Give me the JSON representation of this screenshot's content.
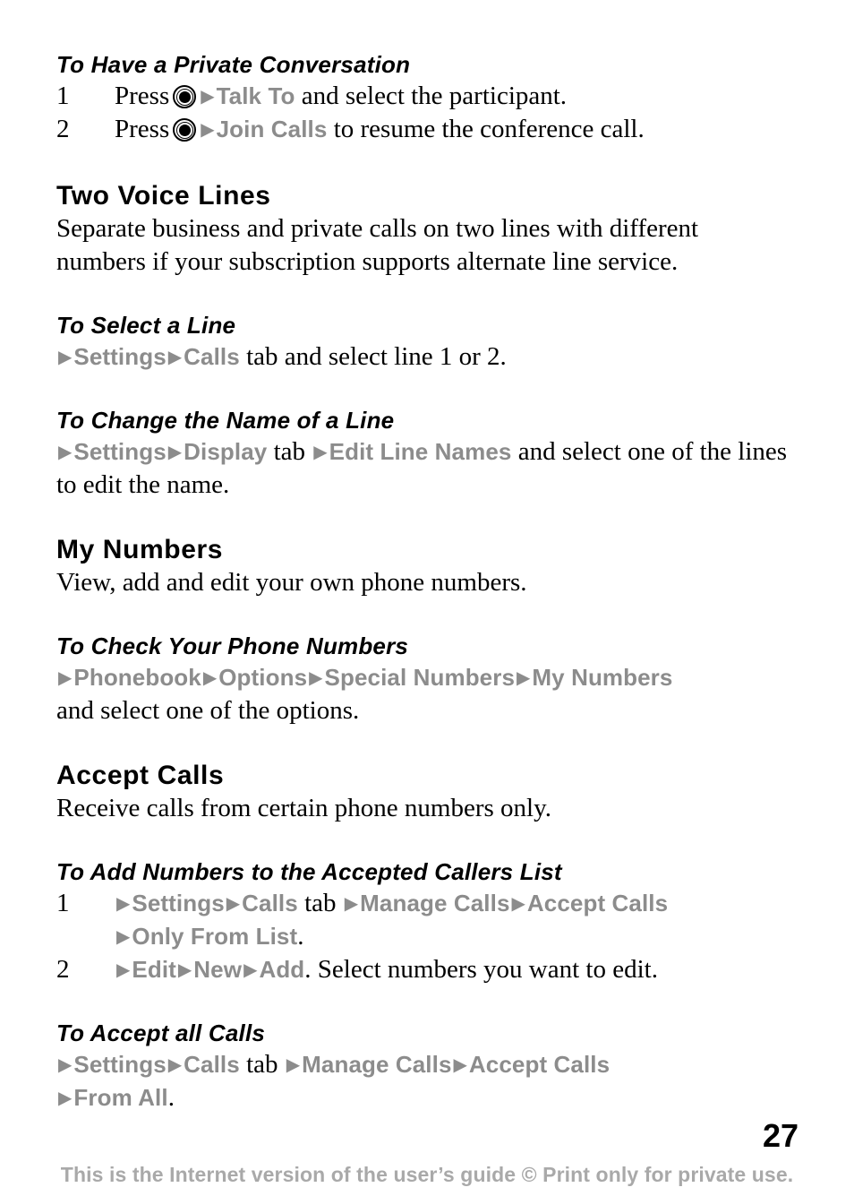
{
  "document": {
    "page_number": "27",
    "footer_note": "This is the Internet version of the user’s guide © Print only for private use.",
    "colors": {
      "menu_term": "#8c8c8c",
      "footer": "#a9a9a9",
      "body_text": "#000000"
    },
    "icons": {
      "joystick": "joystick-icon",
      "arrow": "▶"
    }
  },
  "sections": {
    "private_conversation": {
      "heading": "To Have a Private Conversation",
      "steps": [
        {
          "number": "1",
          "press_label": "Press",
          "menu": "Talk To",
          "tail": " and select the participant."
        },
        {
          "number": "2",
          "press_label": "Press",
          "menu": "Join Calls",
          "tail": " to resume the conference call."
        }
      ]
    },
    "two_voice_lines": {
      "heading": "Two Voice Lines",
      "body": "Separate business and private calls on two lines with different numbers if your subscription supports alternate line service."
    },
    "select_a_line": {
      "heading": "To Select a Line",
      "menu_1": "Settings",
      "menu_2": "Calls",
      "tab_word": " tab ",
      "tail": " and select line 1 or 2."
    },
    "change_line_name": {
      "heading": "To Change the Name of a Line",
      "menu_1": "Settings",
      "menu_2": "Display",
      "tab_word": " tab ",
      "menu_3": "Edit Line Names",
      "tail": " and select one of the lines to edit the name."
    },
    "my_numbers": {
      "heading": "My Numbers",
      "body": "View, add and edit your own phone numbers."
    },
    "check_phone_numbers": {
      "heading": "To Check Your Phone Numbers",
      "menu_1": "Phonebook",
      "menu_2": "Options",
      "menu_3": "Special Numbers",
      "menu_4": "My Numbers",
      "tail": "and select one of the options."
    },
    "accept_calls": {
      "heading": "Accept Calls",
      "body": "Receive calls from certain phone numbers only."
    },
    "add_accepted_callers": {
      "heading": "To Add Numbers to the Accepted Callers List",
      "step1": {
        "number": "1",
        "menu_1": "Settings",
        "menu_2": "Calls",
        "tab_word": " tab ",
        "menu_3": "Manage Calls",
        "menu_4": "Accept Calls",
        "menu_5": "Only From List",
        "period": "."
      },
      "step2": {
        "number": "2",
        "menu_1": "Edit",
        "menu_2": "New",
        "menu_3": "Add",
        "tail": ". Select numbers you want to edit."
      }
    },
    "accept_all_calls": {
      "heading": "To Accept all Calls",
      "menu_1": "Settings",
      "menu_2": "Calls",
      "tab_word": " tab ",
      "menu_3": "Manage Calls",
      "menu_4": "Accept Calls",
      "menu_5": "From All",
      "period": "."
    }
  }
}
